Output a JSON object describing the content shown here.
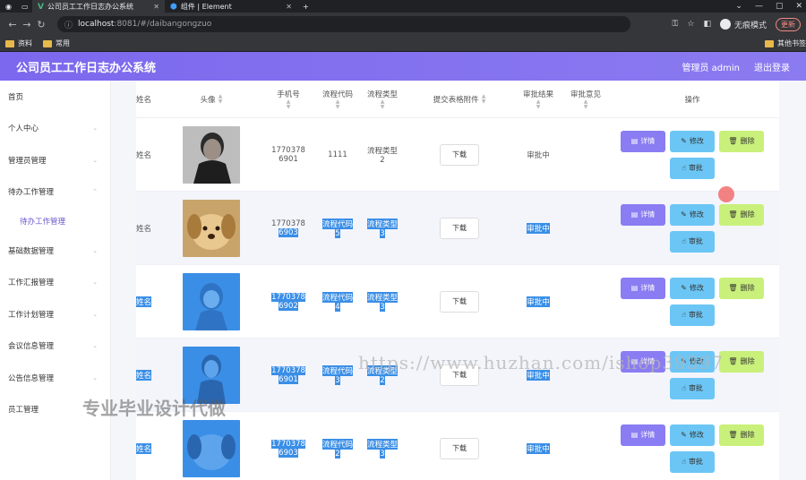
{
  "browser": {
    "tabs": [
      {
        "title": "公司员工工作日志办公系统",
        "active": true
      },
      {
        "title": "组件 | Element",
        "active": false
      }
    ],
    "url_host": "localhost",
    "url_path": ":8081/#/daibangongzuo",
    "incognito_label": "无痕模式",
    "update_label": "更新",
    "bookmarks": [
      "资料",
      "常用"
    ],
    "other_bookmarks": "其他书签"
  },
  "header": {
    "title": "公司员工工作日志办公系统",
    "admin_label": "管理员 admin",
    "logout_label": "退出登录"
  },
  "sidebar": {
    "items": [
      {
        "label": "首页",
        "chevron": false
      },
      {
        "label": "个人中心",
        "chevron": true
      },
      {
        "label": "管理员管理",
        "chevron": true
      },
      {
        "label": "待办工作管理",
        "chevron": true
      },
      {
        "label": "待办工作管理",
        "sub": true
      },
      {
        "label": "基础数据管理",
        "chevron": true
      },
      {
        "label": "工作汇报管理",
        "chevron": true
      },
      {
        "label": "工作计划管理",
        "chevron": true
      },
      {
        "label": "会议信息管理",
        "chevron": true
      },
      {
        "label": "公告信息管理",
        "chevron": true
      },
      {
        "label": "员工管理",
        "chevron": true
      }
    ]
  },
  "table": {
    "columns": {
      "name": "姓名",
      "avatar": "头像",
      "phone": "手机号",
      "flow_code": "流程代码",
      "flow_type": "流程类型",
      "attachment": "提交表格附件",
      "result": "审批结果",
      "opinion": "审批意见",
      "ops": "操作"
    },
    "buttons": {
      "download": "下载",
      "detail": "详情",
      "edit": "修改",
      "delete": "删除",
      "approve": "审批"
    },
    "rows": [
      {
        "name": "姓名",
        "phone1": "1770378",
        "phone2": "6901",
        "code": "1111",
        "type1": "流程类型",
        "type2": "2",
        "result": "审批中",
        "selected": false
      },
      {
        "name": "姓名",
        "phone1": "1770378",
        "phone2": "6903",
        "code1": "流程代码",
        "code2": "5",
        "type1": "流程类型",
        "type2": "3",
        "result": "审批中",
        "selected": true
      },
      {
        "name": "姓名",
        "phone1": "1770378",
        "phone2": "6902",
        "code1": "流程代码",
        "code2": "4",
        "type1": "流程类型",
        "type2": "3",
        "result": "审批中",
        "selected": true
      },
      {
        "name": "姓名",
        "phone1": "1770378",
        "phone2": "6901",
        "code1": "流程代码",
        "code2": "3",
        "type1": "流程类型",
        "type2": "2",
        "result": "审批中",
        "selected": true
      },
      {
        "name": "姓名",
        "phone1": "1770378",
        "phone2": "6903",
        "code1": "流程代码",
        "code2": "2",
        "type1": "流程类型",
        "type2": "3",
        "result": "审批中",
        "selected": true
      }
    ]
  },
  "watermarks": {
    "url": "https://www.huzhan.com/ishop39397",
    "slogan": "专业毕业设计代做"
  },
  "colors": {
    "header": "#7b68ee",
    "detail_btn": "#8a7cf2",
    "edit_btn": "#6cc6f5",
    "delete_btn": "#c9f07a",
    "selection": "#3a8ee6"
  }
}
